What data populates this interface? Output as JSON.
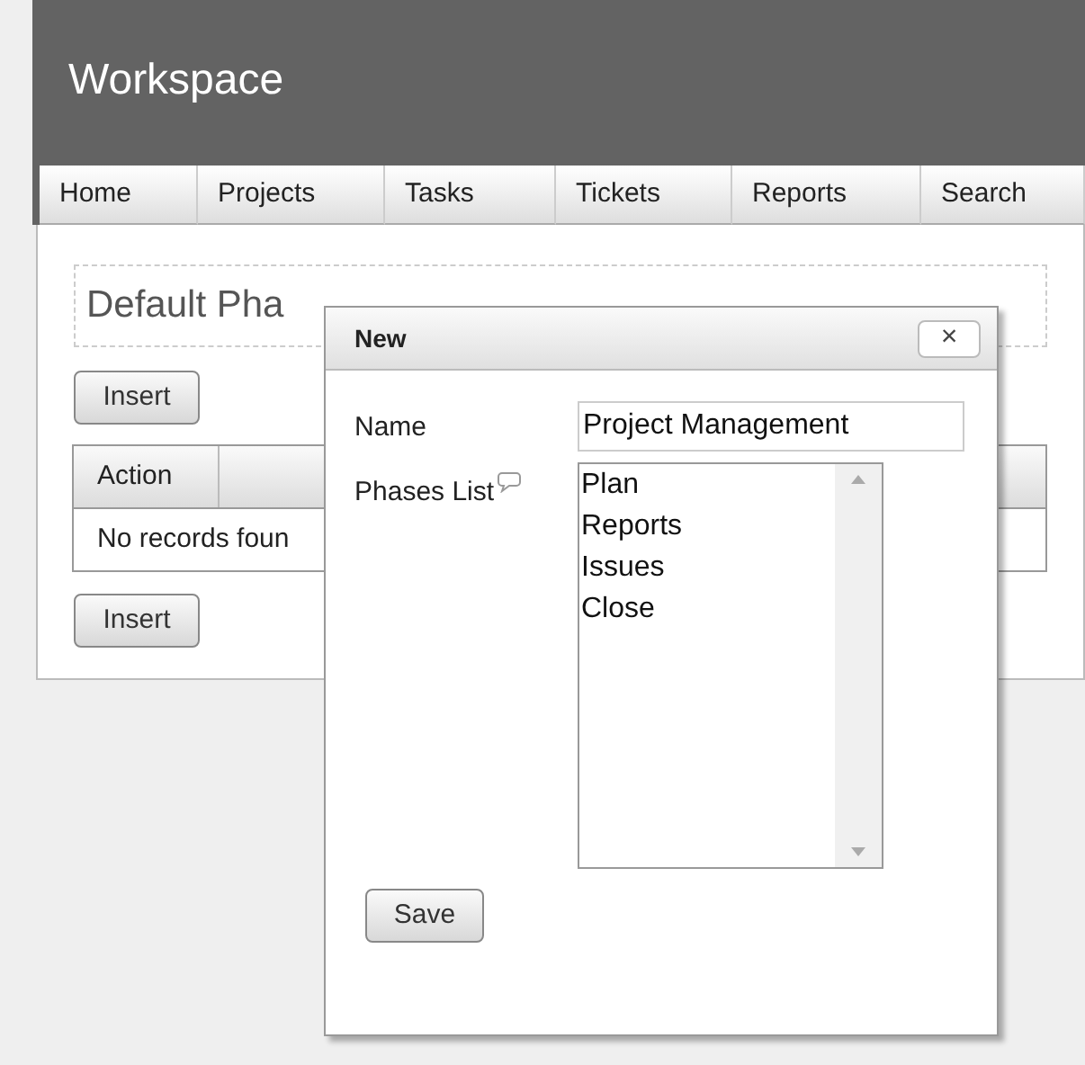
{
  "header": {
    "title": "Workspace"
  },
  "nav": [
    {
      "label": "Home"
    },
    {
      "label": "Projects"
    },
    {
      "label": "Tasks"
    },
    {
      "label": "Tickets"
    },
    {
      "label": "Reports"
    },
    {
      "label": "Search"
    }
  ],
  "section_title": "Default Pha",
  "insert_buttons": [
    "Insert",
    "Insert"
  ],
  "table": {
    "columns": [
      "Action"
    ],
    "empty_message": "No records foun"
  },
  "dialog": {
    "title": "New",
    "close": "×",
    "name_label": "Name",
    "name_value": "Project Management",
    "phases_label": "Phases List",
    "phases": [
      "Plan",
      "Reports",
      "Issues",
      "Close"
    ],
    "save": "Save"
  }
}
